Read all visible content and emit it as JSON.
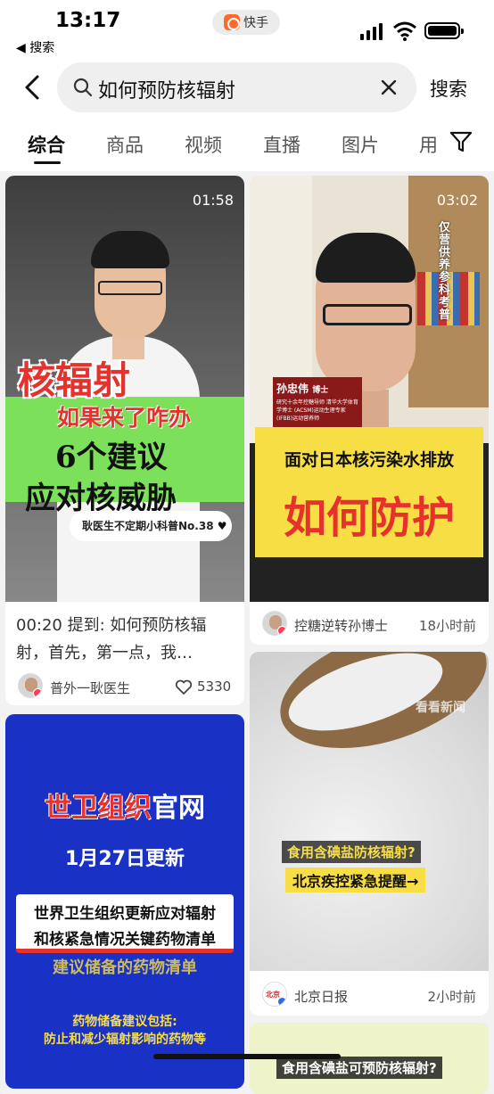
{
  "status_bar": {
    "time": "13:17",
    "back_app": "◀ 搜索",
    "app_name": "快手"
  },
  "search": {
    "query": "如何预防核辐射",
    "button": "搜索"
  },
  "tabs": [
    "综合",
    "商品",
    "视频",
    "直播",
    "图片",
    "用"
  ],
  "cards": [
    {
      "duration": "01:58",
      "overlay": {
        "line1": "核辐射",
        "line2": "如果来了咋办",
        "line3": "6个建议",
        "line4": "应对核威胁",
        "tag": "耿医生不定期小科普No.38"
      },
      "desc": "00:20 提到: 如何预防核辐射，首先，第一点，我…",
      "author": "普外一耿医生",
      "likes": "5330"
    },
    {
      "duration": "03:02",
      "overlay": {
        "side": "仅营供养参科考普",
        "name": "孙忠伟",
        "name_title": "博士",
        "bio": "研究十余年控糖导师 清华大学体育学博士 (ACSM)运动生理专家 (IFBB)运动营养师",
        "banner1": "面对日本核污染水排放",
        "banner2": "如何防护"
      },
      "author": "控糖逆转孙博士",
      "time": "18小时前"
    },
    {
      "overlay": {
        "title_red": "世卫组织",
        "title_blue": "官网",
        "date": "1月27日更新",
        "box1": "世界卫生组织更新应对辐射",
        "box2": "和核紧急情况关键药物清单",
        "sub": "建议储备的药物清单",
        "note1": "药物储备建议包括:",
        "note2": "防止和减少辐射影响的药物等"
      }
    },
    {
      "overlay": {
        "line1": "食用含碘盐防核辐射?",
        "line2": "北京疾控紧急提醒→",
        "watermark": "看看新闻"
      },
      "author": "北京日报",
      "time": "2小时前"
    },
    {
      "overlay": {
        "line1": "食用含碘盐可预防核辐射?"
      }
    }
  ],
  "colors": {
    "accent": "#fe3b5a",
    "yellow": "#f8de45",
    "green": "#7de05a",
    "red": "#e5322d",
    "blue": "#1a31c6"
  }
}
